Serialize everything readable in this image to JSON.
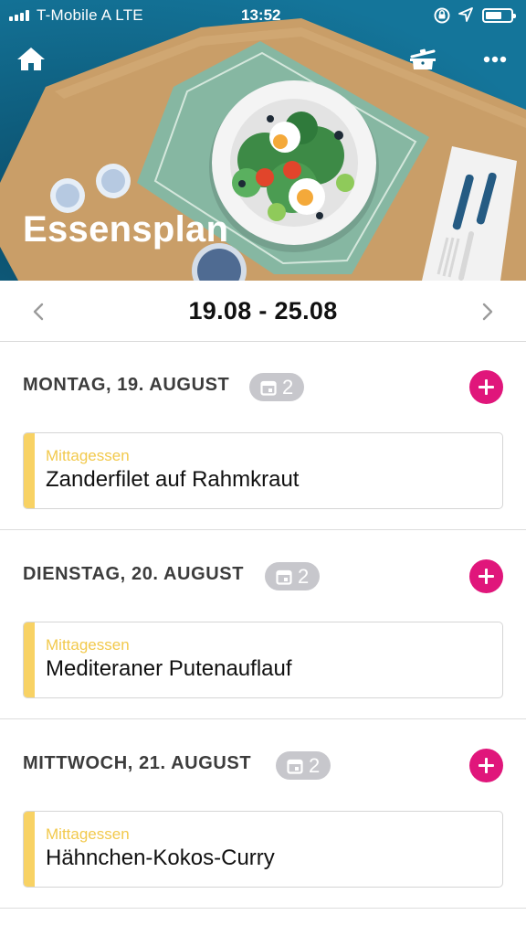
{
  "status_bar": {
    "carrier": "T-Mobile A  LTE",
    "time": "13:52",
    "battery_level": 0.55,
    "icons": [
      "signal-icon",
      "rotation-lock-icon",
      "location-arrow-icon",
      "battery-icon"
    ]
  },
  "header": {
    "title": "Essensplan",
    "icons": [
      "home-icon",
      "cooking-pot-icon",
      "more-icon"
    ]
  },
  "week": {
    "range": "19.08 - 25.08",
    "prev_icon": "chevron-left-icon",
    "next_icon": "chevron-right-icon"
  },
  "days": [
    {
      "label": "MONTAG, 19. AUGUST",
      "count": "2",
      "meals": [
        {
          "type": "Mittagessen",
          "name": "Zanderfilet auf Rahmkraut"
        }
      ]
    },
    {
      "label": "DIENSTAG, 20. AUGUST",
      "count": "2",
      "meals": [
        {
          "type": "Mittagessen",
          "name": "Mediteraner Putenauflauf"
        }
      ]
    },
    {
      "label": "MITTWOCH, 21. AUGUST",
      "count": "2",
      "meals": [
        {
          "type": "Mittagessen",
          "name": "Hähnchen-Kokos-Curry"
        }
      ]
    }
  ],
  "colors": {
    "accent": "#e0167b",
    "meal_stripe": "#f8d264",
    "meal_type": "#f2c94c",
    "badge": "#c7c7cc",
    "hero_bg": "#0e5f7f"
  }
}
